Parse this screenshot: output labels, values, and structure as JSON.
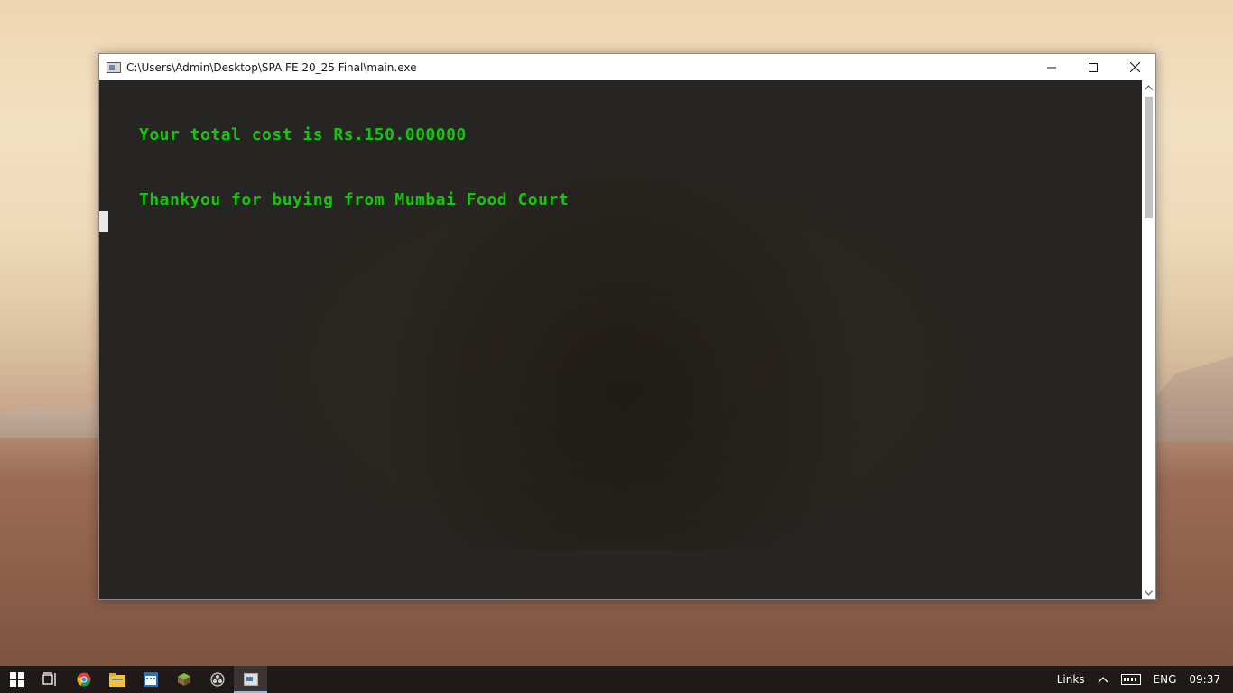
{
  "window": {
    "title": "C:\\Users\\Admin\\Desktop\\SPA FE 20_25 Final\\main.exe",
    "controls": {
      "minimize": "─",
      "maximize": "☐",
      "close": "✕"
    }
  },
  "console": {
    "lines": [
      "Your total cost is Rs.150.000000",
      "Thankyou for buying from Mumbai Food Court"
    ],
    "text_color": "#16c60c"
  },
  "scrollbar": {
    "up": "▲",
    "down": "▼"
  },
  "taskbar": {
    "icons": [
      "windows-start-icon",
      "task-view-icon",
      "chrome-icon",
      "file-explorer-icon",
      "calendar-app-icon",
      "minecraft-icon",
      "obs-icon",
      "console-app-icon"
    ],
    "tray": {
      "links": "Links",
      "chevron": "^",
      "language": "ENG",
      "time": "09:37"
    }
  }
}
